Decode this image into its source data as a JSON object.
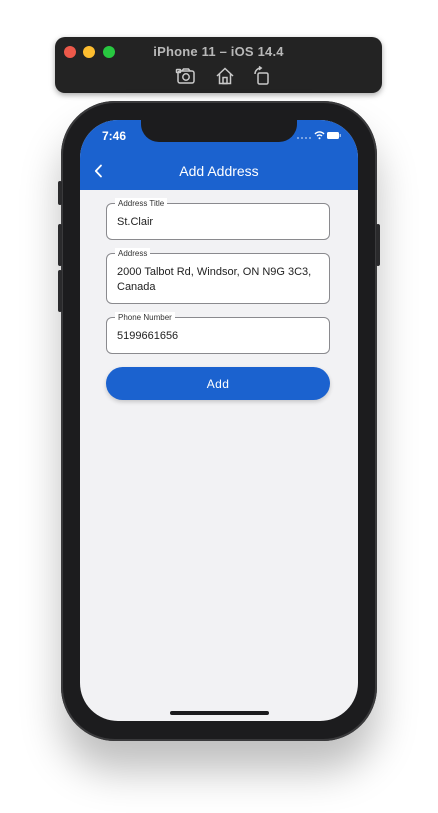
{
  "simulator": {
    "title": "iPhone 11 – iOS 14.4",
    "toolbar_icons": [
      "screenshot-icon",
      "home-icon",
      "rotate-icon"
    ]
  },
  "status_bar": {
    "time": "7:46"
  },
  "header": {
    "title": "Add Address",
    "background": "#1b62cf"
  },
  "form": {
    "fields": [
      {
        "label": "Address Title",
        "value": "St.Clair"
      },
      {
        "label": "Address",
        "value": "2000 Talbot Rd, Windsor, ON N9G 3C3, Canada"
      },
      {
        "label": "Phone Number",
        "value": "5199661656"
      }
    ],
    "submit_label": "Add"
  },
  "colors": {
    "accent": "#1b62cf",
    "screen_background": "#f2f2f4"
  }
}
